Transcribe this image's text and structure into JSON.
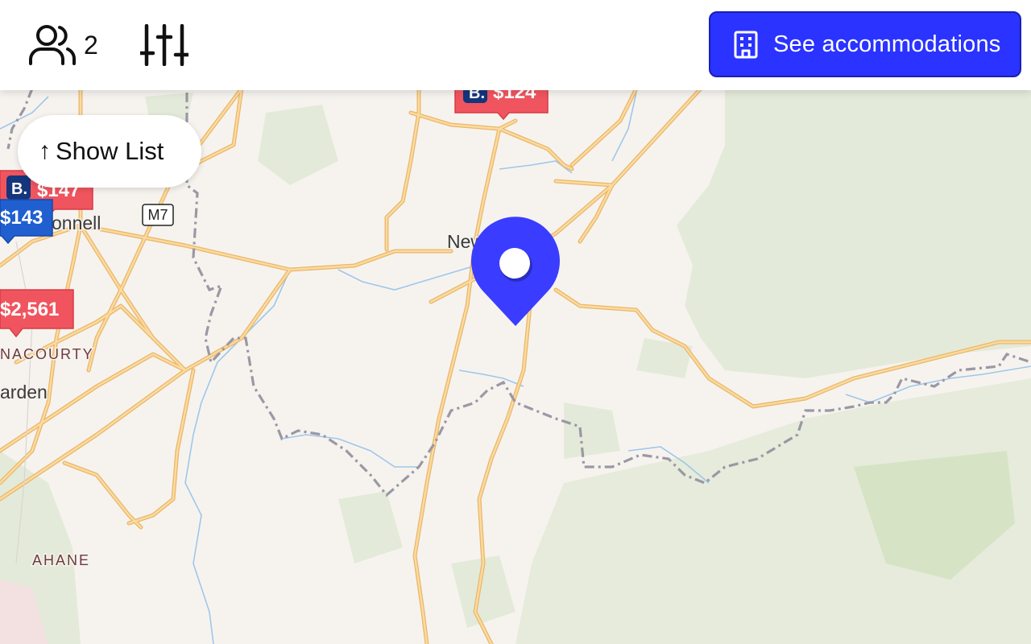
{
  "header": {
    "guests_count": "2",
    "cta_label": "See accommodations",
    "icons": [
      "users-icon",
      "sliders-icon",
      "building-icon"
    ]
  },
  "show_list": {
    "label": "Show List",
    "icon": "arrow-up-icon"
  },
  "map": {
    "places": [
      "Newport",
      "onnell",
      "NACOURTY",
      "arden",
      "AHANE"
    ],
    "road_badge": "M7",
    "price_markers": [
      {
        "price": "$124",
        "provider": "B.",
        "color": "#f0555f"
      },
      {
        "price": "$147",
        "provider": "B.",
        "color": "#f0555f"
      },
      {
        "price": "$143",
        "provider": "",
        "color": "#1f5fd0"
      },
      {
        "price": "$2,561",
        "provider": "",
        "color": "#f0555f"
      }
    ],
    "selected_pin_color": "#3a3dff"
  }
}
